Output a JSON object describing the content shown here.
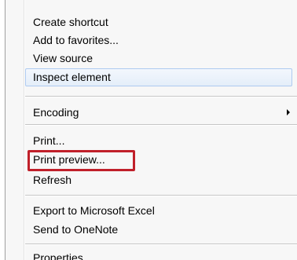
{
  "context_menu": {
    "items": [
      {
        "label": "Create shortcut"
      },
      {
        "label": "Add to favorites..."
      },
      {
        "label": "View source"
      },
      {
        "label": "Inspect element"
      },
      {
        "label": "Encoding"
      },
      {
        "label": "Print..."
      },
      {
        "label": "Print preview..."
      },
      {
        "label": "Refresh"
      },
      {
        "label": "Export to Microsoft Excel"
      },
      {
        "label": "Send to OneNote"
      },
      {
        "label": "Properties"
      }
    ]
  },
  "colors": {
    "highlight_border": "#aecaf0",
    "callout_red": "#c0202a"
  },
  "icons": {
    "submenu_arrow": "chevron-right-icon"
  }
}
